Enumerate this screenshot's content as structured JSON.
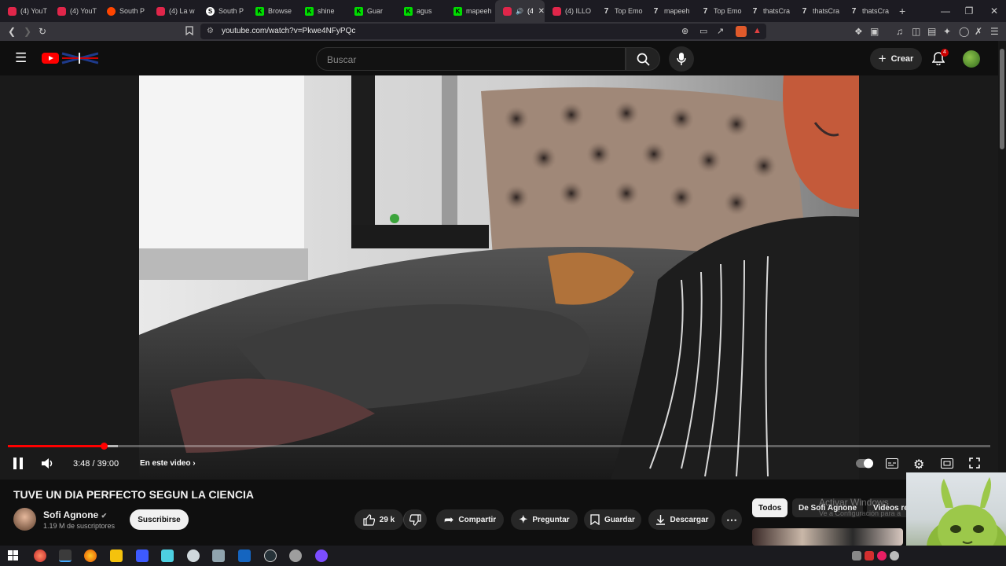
{
  "browser": {
    "tabs": [
      {
        "title": "(4) YouT",
        "icon": "youtube"
      },
      {
        "title": "(4) YouT",
        "icon": "youtube"
      },
      {
        "title": "South P",
        "icon": "reddit"
      },
      {
        "title": "(4) La w",
        "icon": "youtube"
      },
      {
        "title": "South P",
        "icon": "s"
      },
      {
        "title": "Browse",
        "icon": "kick"
      },
      {
        "title": "shine",
        "icon": "kick"
      },
      {
        "title": "Guar",
        "icon": "kick"
      },
      {
        "title": "agus",
        "icon": "kick"
      },
      {
        "title": "mapeeh",
        "icon": "kick"
      },
      {
        "title": "(4",
        "icon": "youtube",
        "active": true
      },
      {
        "title": "(4) ILLO",
        "icon": "youtube"
      },
      {
        "title": "Top Emo",
        "icon": "7tv"
      },
      {
        "title": "mapeeh",
        "icon": "7tv"
      },
      {
        "title": "Top Emo",
        "icon": "7tv"
      },
      {
        "title": "thatsCra",
        "icon": "7tv"
      },
      {
        "title": "thatsCra",
        "icon": "7tv"
      },
      {
        "title": "thatsCra",
        "icon": "7tv"
      }
    ],
    "new_tab": "+",
    "url": "youtube.com/watch?v=Pkwe4NFyPQc"
  },
  "youtube": {
    "search_placeholder": "Buscar",
    "create_label": "Crear",
    "notifications_count": "4"
  },
  "player": {
    "time": "3:48 / 39:00",
    "chapter_label": "En este video",
    "progress_fraction": 0.0975,
    "buffered_fraction": 0.112
  },
  "video": {
    "title": "TUVE UN DIA PERFECTO SEGUN LA CIENCIA",
    "channel_name": "Sofi Agnone",
    "verified": "✔",
    "subscribers": "1.19 M de suscriptores",
    "subscribe_label": "Suscribirse",
    "likes": "29 k",
    "share_label": "Compartir",
    "ask_label": "Preguntar",
    "save_label": "Guardar",
    "download_label": "Descargar"
  },
  "related": {
    "chips": [
      "Todos",
      "De Sofi Agnone",
      "Videos re"
    ]
  },
  "overlay": {
    "activate_windows": "Activar Windows",
    "activate_hint": "Ve a Configuración para a"
  },
  "colors": {
    "accent": "#ff0000",
    "background": "#0f0f0f",
    "chip_active": "#f1f1f1",
    "pill": "#272727"
  }
}
